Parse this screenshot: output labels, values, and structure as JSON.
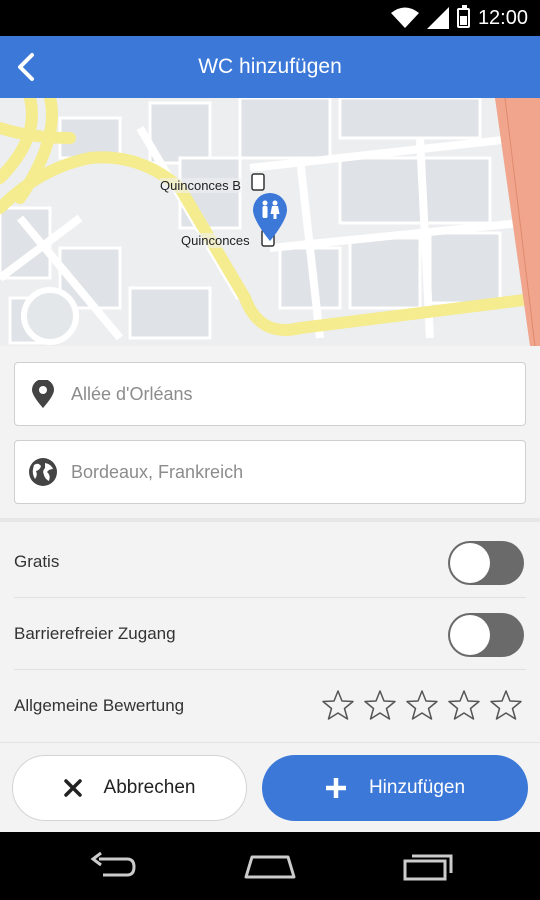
{
  "status_bar": {
    "time": "12:00"
  },
  "app_bar": {
    "title": "WC hinzufügen"
  },
  "map": {
    "labels": [
      "Quinconces B",
      "Quinconces"
    ]
  },
  "fields": {
    "street_placeholder": "Allée d'Orléans",
    "city_placeholder": "Bordeaux, Frankreich"
  },
  "options": {
    "free_label": "Gratis",
    "free_on": false,
    "accessible_label": "Barrierefreier Zugang",
    "accessible_on": false,
    "rating_label": "Allgemeine Bewertung",
    "rating_value": 0,
    "rating_max": 5
  },
  "actions": {
    "cancel_label": "Abbrechen",
    "add_label": "Hinzufügen"
  },
  "colors": {
    "primary": "#3c78d8",
    "toggle_off": "#6a6a6a",
    "road_yellow": "#f5ec8f",
    "road_red": "#f0a58c"
  },
  "icons": [
    "back-arrow-icon",
    "location-pin-icon",
    "globe-icon",
    "toilet-marker-icon",
    "star-icon",
    "close-icon",
    "plus-icon",
    "wifi-icon",
    "signal-icon",
    "battery-icon",
    "nav-back-icon",
    "nav-home-icon",
    "nav-recents-icon"
  ]
}
